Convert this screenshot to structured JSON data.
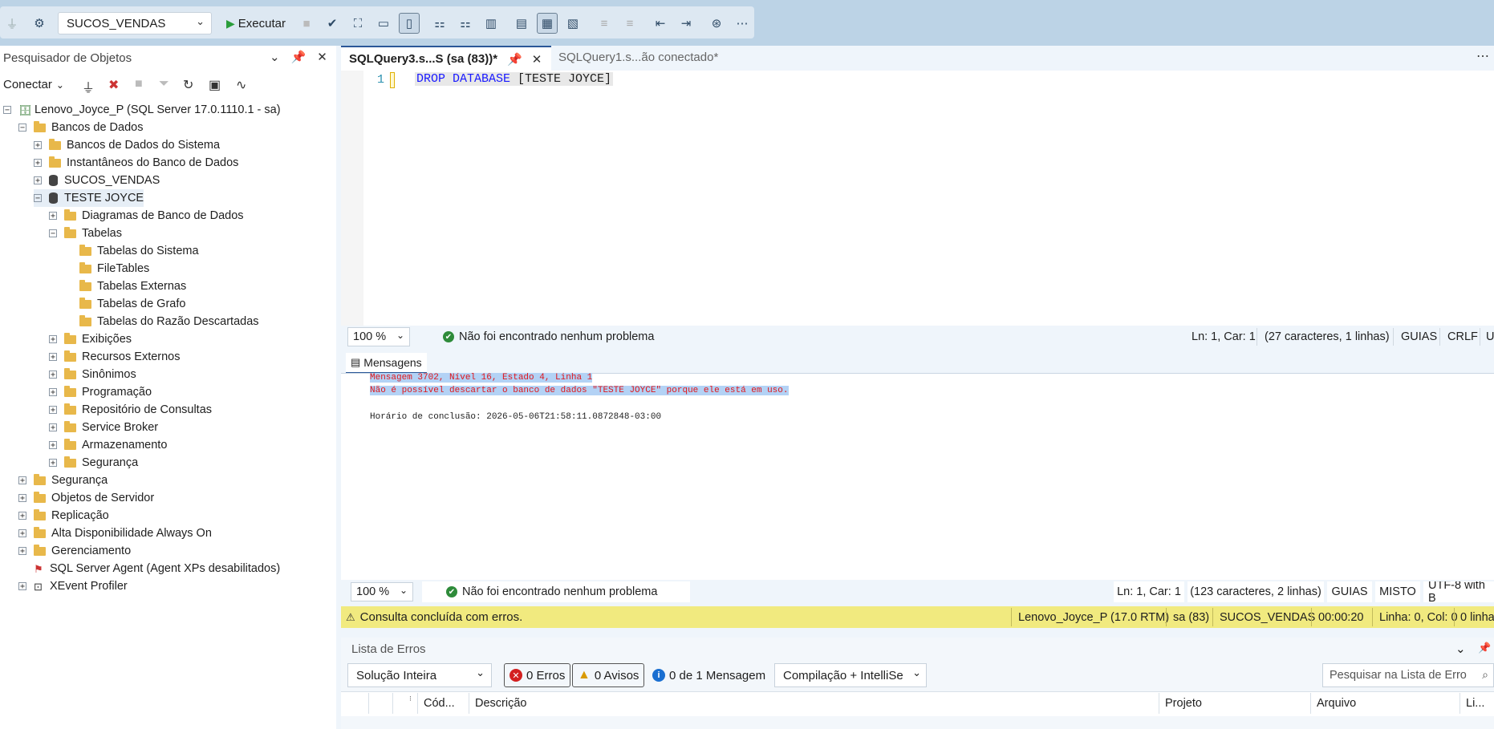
{
  "toolbar": {
    "database": "SUCOS_VENDAS",
    "execute_label": "Executar"
  },
  "object_explorer": {
    "title": "Pesquisador de Objetos",
    "connect_label": "Conectar",
    "tree": [
      {
        "label": "Lenovo_Joyce_P (SQL Server 17.0.1110.1 - sa)",
        "expander": "⊟"
      },
      {
        "label": "Bancos de Dados",
        "expander": "⊟"
      },
      {
        "label": "Bancos de Dados do Sistema",
        "expander": "⊞"
      },
      {
        "label": "Instantâneos do Banco de Dados",
        "expander": "⊞"
      },
      {
        "label": "SUCOS_VENDAS",
        "expander": "⊞"
      },
      {
        "label": "TESTE JOYCE",
        "expander": "⊟"
      },
      {
        "label": "Diagramas de Banco de Dados",
        "expander": "⊞"
      },
      {
        "label": "Tabelas",
        "expander": "⊟"
      },
      {
        "label": "Tabelas do Sistema",
        "expander": ""
      },
      {
        "label": "FileTables",
        "expander": ""
      },
      {
        "label": "Tabelas Externas",
        "expander": ""
      },
      {
        "label": "Tabelas de Grafo",
        "expander": ""
      },
      {
        "label": "Tabelas do Razão Descartadas",
        "expander": ""
      },
      {
        "label": "Exibições",
        "expander": "⊞"
      },
      {
        "label": "Recursos Externos",
        "expander": "⊞"
      },
      {
        "label": "Sinônimos",
        "expander": "⊞"
      },
      {
        "label": "Programação",
        "expander": "⊞"
      },
      {
        "label": "Repositório de Consultas",
        "expander": "⊞"
      },
      {
        "label": "Service Broker",
        "expander": "⊞"
      },
      {
        "label": "Armazenamento",
        "expander": "⊞"
      },
      {
        "label": "Segurança",
        "expander": "⊞"
      },
      {
        "label": "Segurança",
        "expander": "⊞"
      },
      {
        "label": "Objetos de Servidor",
        "expander": "⊞"
      },
      {
        "label": "Replicação",
        "expander": "⊞"
      },
      {
        "label": "Alta Disponibilidade Always On",
        "expander": "⊞"
      },
      {
        "label": "Gerenciamento",
        "expander": "⊞"
      },
      {
        "label": "SQL Server Agent (Agent XPs desabilitados)",
        "expander": ""
      },
      {
        "label": "XEvent Profiler",
        "expander": "⊞"
      }
    ]
  },
  "editor": {
    "tabs": [
      "SQLQuery3.s...S (sa (83))*",
      "SQLQuery1.s...ão conectado*"
    ],
    "line_number": "1",
    "code_keyword": "DROP DATABASE",
    "code_rest": " [TESTE JOYCE]"
  },
  "editor_status": {
    "zoom": "100 %",
    "problems": "Não foi encontrado nenhum problema",
    "position": "Ln: 1, Car: 1",
    "chars": "(27 caracteres, 1 linhas)",
    "guides": "GUIAS",
    "eol": "CRLF",
    "encoding": "U"
  },
  "messages": {
    "tab_label": "Mensagens",
    "error_line1": "Mensagem 3702, Nível 16, Estado 4, Linha 1",
    "error_line2": "Não é possível descartar o banco de dados \"TESTE JOYCE\" porque ele está em uso.",
    "completion": "Horário de conclusão: 2026-05-06T21:58:11.0872848-03:00"
  },
  "results_status": {
    "zoom": "100 %",
    "problems": "Não foi encontrado nenhum problema",
    "position": "Ln: 1, Car: 1",
    "chars": "(123 caracteres, 2 linhas)",
    "guides": "GUIAS",
    "eol": "MISTO",
    "encoding": "UTF-8 with B"
  },
  "query_status": {
    "message": "Consulta concluída com erros.",
    "server": "Lenovo_Joyce_P (17.0 RTM)",
    "user": "sa (83)",
    "database": "SUCOS_VENDAS",
    "elapsed": "00:00:20",
    "position": "Linha: 0, Col: 0",
    "rows": "0 linha"
  },
  "error_list": {
    "title": "Lista de Erros",
    "scope": "Solução Inteira",
    "errors": "0 Erros",
    "warnings": "0 Avisos",
    "messages": "0 de 1 Mensagem",
    "build_filter": "Compilação + IntelliSe",
    "search_placeholder": "Pesquisar na Lista de Erro",
    "columns": [
      "Cód...",
      "Descrição",
      "Projeto",
      "Arquivo",
      "Li..."
    ]
  }
}
